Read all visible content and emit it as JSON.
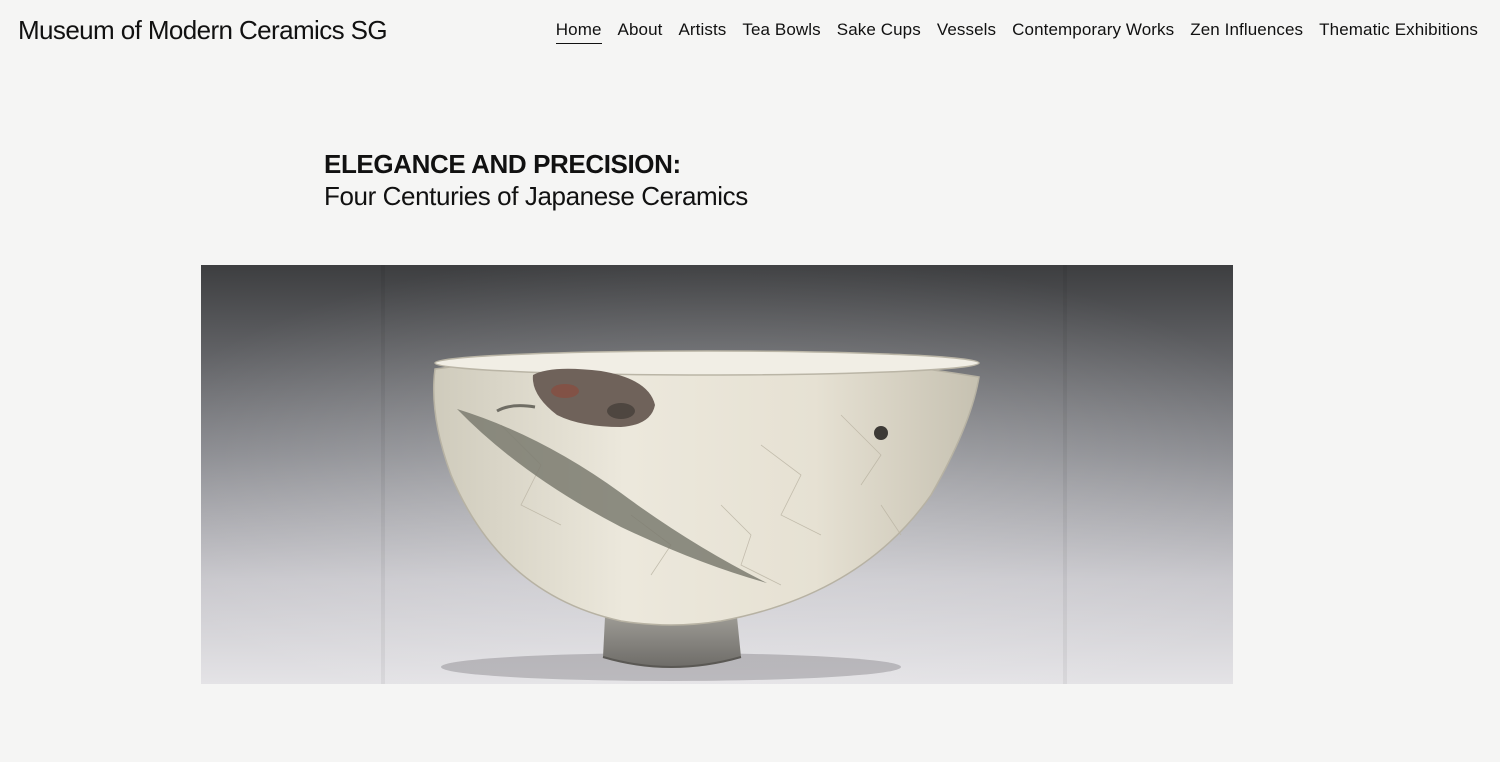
{
  "header": {
    "site_title": "Museum of Modern Ceramics SG",
    "nav": [
      {
        "label": "Home",
        "active": true
      },
      {
        "label": "About",
        "active": false
      },
      {
        "label": "Artists",
        "active": false
      },
      {
        "label": "Tea Bowls",
        "active": false
      },
      {
        "label": "Sake Cups",
        "active": false
      },
      {
        "label": "Vessels",
        "active": false
      },
      {
        "label": "Contemporary Works",
        "active": false
      },
      {
        "label": "Zen Influences",
        "active": false
      },
      {
        "label": "Thematic Exhibitions",
        "active": false
      }
    ]
  },
  "hero": {
    "title": "ELEGANCE AND PRECISION:",
    "subtitle": "Four Centuries of Japanese Ceramics",
    "image": {
      "subject": "white-glazed-tea-bowl-with-leaf-motif"
    }
  },
  "colors": {
    "background": "#f5f5f4",
    "text": "#111111",
    "glaze": "#e7e3d8",
    "leaf": "#7a7a6e"
  }
}
